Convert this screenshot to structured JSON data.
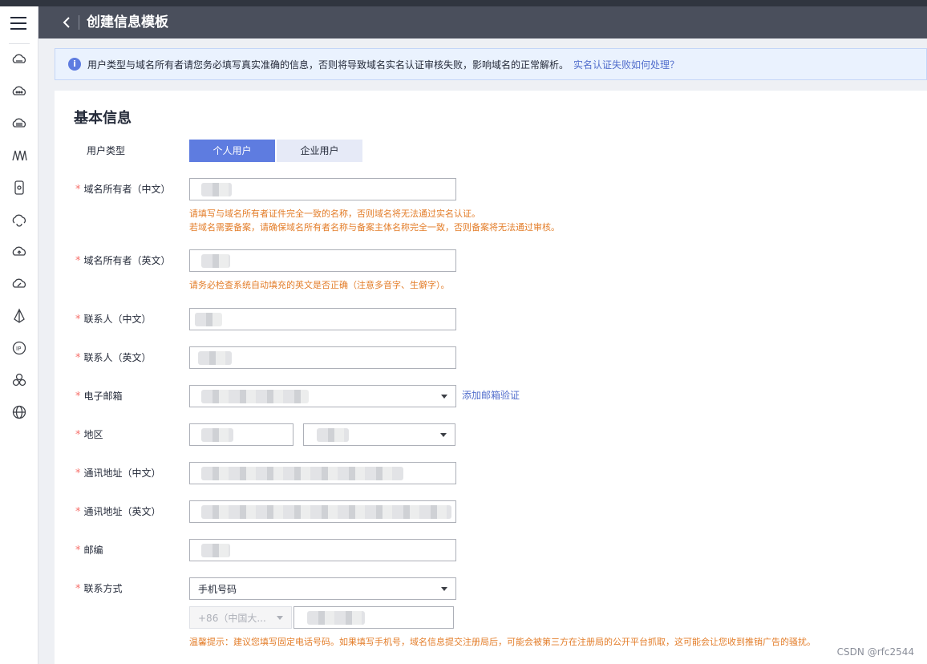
{
  "header": {
    "title": "创建信息模板"
  },
  "sidebar": {
    "icons": [
      "cloud-server-icon",
      "cloud-icon",
      "cloud-storage-icon",
      "network-icon",
      "device-icon",
      "cloud-sync-icon",
      "cloud-upload-icon",
      "cloud-speed-icon",
      "distribute-icon",
      "ip-icon",
      "cluster-icon",
      "domain-globe-icon"
    ]
  },
  "notice": {
    "text": "用户类型与域名所有者请您务必填写真实准确的信息，否则将导致域名实名认证审核失败，影响域名的正常解析。",
    "link": "实名认证失败如何处理？"
  },
  "form": {
    "section_title": "基本信息",
    "user_type": {
      "label": "用户类型",
      "options": [
        "个人用户",
        "企业用户"
      ],
      "selected": "个人用户"
    },
    "owner_cn": {
      "label": "域名所有者（中文）",
      "hint1": "请填写与域名所有者证件完全一致的名称，否则域名将无法通过实名认证。",
      "hint2": "若域名需要备案，请确保域名所有者名称与备案主体名称完全一致，否则备案将无法通过审核。"
    },
    "owner_en": {
      "label": "域名所有者（英文）",
      "hint": "请务必检查系统自动填充的英文是否正确（注意多音字、生僻字）。"
    },
    "contact_cn": {
      "label": "联系人（中文）"
    },
    "contact_en": {
      "label": "联系人（英文）"
    },
    "email": {
      "label": "电子邮箱",
      "link": "添加邮箱验证"
    },
    "region": {
      "label": "地区"
    },
    "address_cn": {
      "label": "通讯地址（中文）"
    },
    "address_en": {
      "label": "通讯地址（英文）"
    },
    "postcode": {
      "label": "邮编"
    },
    "contact_method": {
      "label": "联系方式",
      "value": "手机号码",
      "country_code": "+86（中国大...",
      "hint": "温馨提示：建议您填写固定电话号码。如果填写手机号，域名信息提交注册局后，可能会被第三方在注册局的公开平台抓取，这可能会让您收到推销广告的骚扰。"
    },
    "required_mark": "*"
  },
  "watermark": "CSDN @rfc2544",
  "colors": {
    "accent": "#5e7ce0",
    "hint": "#e37d29",
    "required": "#f66f6a",
    "header": "#4a4f5c"
  }
}
